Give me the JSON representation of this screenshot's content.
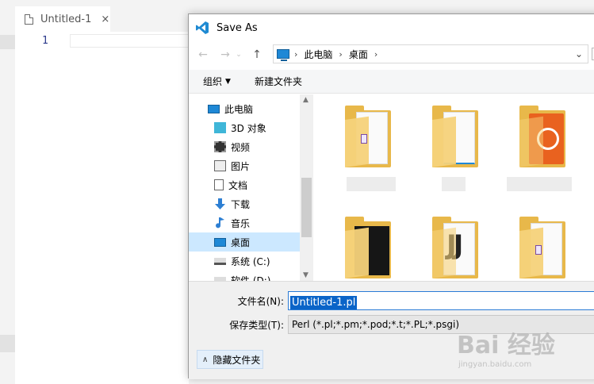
{
  "editor": {
    "tab_title": "Untitled-1",
    "tab_close": "×",
    "line_number": "1"
  },
  "dialog": {
    "title": "Save As",
    "nav": {
      "back": "←",
      "forward": "→",
      "dropdown": "⌄",
      "up": "↑"
    },
    "breadcrumb": [
      "此电脑",
      "桌面"
    ],
    "crumb_sep": "›",
    "toolbar": {
      "organize": "组织",
      "organize_arrow": "▼",
      "new_folder": "新建文件夹"
    },
    "nav_items": [
      {
        "label": "此电脑",
        "icon": "computer-icon"
      },
      {
        "label": "3D 对象",
        "icon": "cube-icon"
      },
      {
        "label": "视频",
        "icon": "video-icon"
      },
      {
        "label": "图片",
        "icon": "picture-icon"
      },
      {
        "label": "文档",
        "icon": "document-icon"
      },
      {
        "label": "下载",
        "icon": "download-icon"
      },
      {
        "label": "音乐",
        "icon": "music-icon"
      },
      {
        "label": "桌面",
        "icon": "desktop-icon",
        "selected": true
      },
      {
        "label": "系统 (C:)",
        "icon": "drive-icon"
      },
      {
        "label": "软件 (D:)",
        "icon": "drive-icon"
      }
    ],
    "filename_label": "文件名(N):",
    "filename_value": "Untitled-1.pl",
    "filetype_label": "保存类型(T):",
    "filetype_value": "Perl (*.pl;*.pm;*.pod;*.t;*.PL;*.psgi)",
    "hide_folders": "隐藏文件夹",
    "hide_chevron": "∧"
  },
  "watermark": {
    "main": "Bai 经验",
    "sub": "jingyan.baidu.com"
  },
  "colors": {
    "accent": "#0a64c8",
    "selection": "#cce8ff",
    "folder": "#e8b84a"
  }
}
